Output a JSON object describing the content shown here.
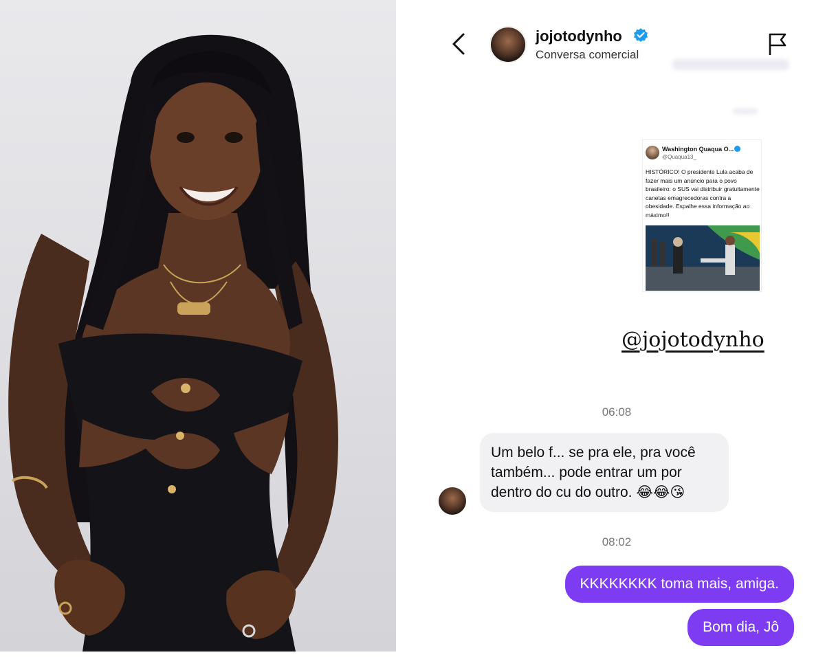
{
  "header": {
    "name": "jojotodynho",
    "subtitle": "Conversa comercial"
  },
  "shared_post": {
    "author_name": "Washington Quaqua O...",
    "author_handle": "@Quaqua13_",
    "text": "HISTÓRICO! O presidente Lula acaba de fazer mais um anúncio para o povo brasileiro: o SUS vai distribuir gratuitamente canetas emagrecedoras contra a obesidade. Espalhe essa informação ao máximo!!",
    "mention": "@jojotodynho"
  },
  "messages": [
    {
      "type": "timestamp",
      "text": "06:08"
    },
    {
      "type": "incoming",
      "text": "Um belo f... se pra ele, pra você também... pode entrar um por dentro do cu do outro. 😂😂😘"
    },
    {
      "type": "timestamp",
      "text": "08:02"
    },
    {
      "type": "outgoing",
      "text": "KKKKKKKK toma mais, amiga."
    },
    {
      "type": "outgoing",
      "text": "Bom dia, Jô"
    }
  ],
  "colors": {
    "outgoing_bubble": "#7d3cf2",
    "incoming_bubble": "#f1f1f3",
    "verified": "#1d9bf0",
    "timestamp": "#777777"
  },
  "icons": {
    "back": "chevron-left-icon",
    "report": "flag-icon",
    "verified": "verified-badge-icon"
  }
}
